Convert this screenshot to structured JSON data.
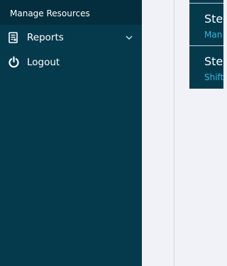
{
  "sidebar": {
    "header": "Manage Resources",
    "items": [
      {
        "label": "Reports",
        "icon": "report-icon",
        "has_submenu": true
      },
      {
        "label": "Logout",
        "icon": "power-icon",
        "has_submenu": false
      }
    ]
  },
  "steps": [
    {
      "title": "Step",
      "subtitle": "Man"
    },
    {
      "title": "Step",
      "subtitle": "Shift"
    }
  ],
  "colors": {
    "sidebar_bg": "#053a4d",
    "header_bg": "#042d3d",
    "page_bg": "#f1f2f7",
    "accent": "#39b3de"
  }
}
